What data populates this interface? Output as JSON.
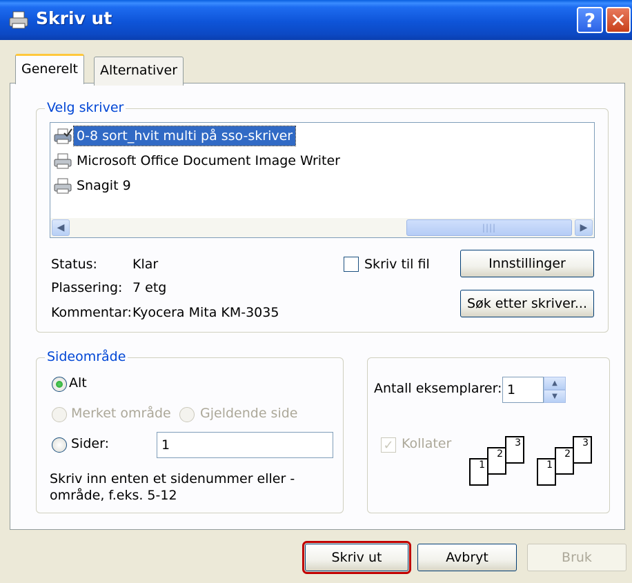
{
  "window": {
    "title": "Skriv ut",
    "help_label": "?",
    "close_label": "✕"
  },
  "tabs": [
    {
      "label": "Generelt",
      "active": true
    },
    {
      "label": "Alternativer",
      "active": false
    }
  ],
  "printer_group": {
    "legend": "Velg skriver",
    "printers": [
      {
        "name": "0-8 sort_hvit multi på sso-skriver",
        "selected": true
      },
      {
        "name": "Microsoft Office Document Image Writer",
        "selected": false
      },
      {
        "name": "Snagit 9",
        "selected": false
      }
    ],
    "status_label": "Status:",
    "status_value": "Klar",
    "location_label": "Plassering:",
    "location_value": "7 etg",
    "comment_label": "Kommentar:",
    "comment_value": "Kyocera Mita KM-3035",
    "print_to_file_label": "Skriv til fil",
    "settings_button": "Innstillinger",
    "find_printer_button": "Søk etter skriver..."
  },
  "page_range": {
    "legend": "Sideområde",
    "all_label": "Alt",
    "selection_label": "Merket område",
    "current_page_label": "Gjeldende side",
    "pages_label": "Sider:",
    "pages_value": "1",
    "hint": "Skriv inn enten et sidenummer eller -område, f.eks. 5-12"
  },
  "copies": {
    "label": "Antall eksemplarer:",
    "value": "1",
    "collate_label": "Kollater",
    "collate_checked": true,
    "page_numbers": [
      "1",
      "2",
      "3"
    ]
  },
  "footer": {
    "print_button": "Skriv ut",
    "cancel_button": "Avbryt",
    "apply_button": "Bruk"
  },
  "colors": {
    "accent": "#0046D5",
    "selection": "#316AC5",
    "default_button_highlight": "#C00000"
  }
}
